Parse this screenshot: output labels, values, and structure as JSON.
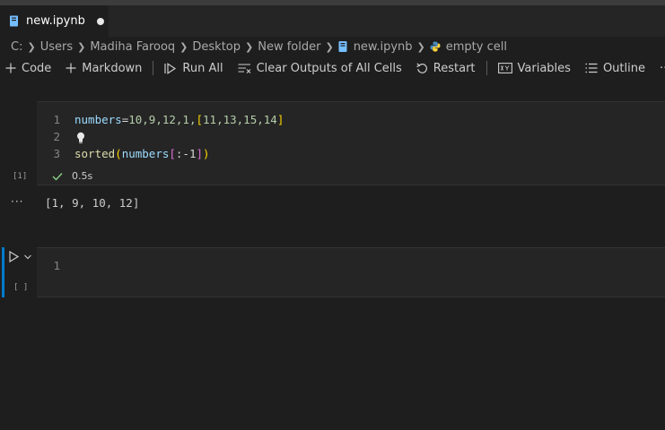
{
  "tab": {
    "title": "new.ipynb"
  },
  "breadcrumb": {
    "parts": [
      "C:",
      "Users",
      "Madiha Farooq",
      "Desktop",
      "New folder"
    ],
    "file": "new.ipynb",
    "cell": "empty cell"
  },
  "toolbar": {
    "code": "Code",
    "markdown": "Markdown",
    "run_all": "Run All",
    "clear_outputs": "Clear Outputs of All Cells",
    "restart": "Restart",
    "variables": "Variables",
    "outline": "Outline",
    "more": "···"
  },
  "cell1": {
    "line_numbers": [
      "1",
      "2",
      "3"
    ],
    "line1": {
      "var": "numbers",
      "eq": "=",
      "nums": "10,9,12,1,",
      "open": "[",
      "list": "11,13,15,14",
      "close": "]"
    },
    "line3": {
      "fn": "sorted",
      "open": "(",
      "var": "numbers",
      "sopen": "[",
      "slice": ":-1",
      "sclose": "]",
      "close": ")"
    },
    "exec_count": "[1]",
    "duration": "0.5s",
    "output_marker": "···",
    "output": "[1, 9, 10, 12]"
  },
  "cell2": {
    "line_numbers": [
      "1"
    ],
    "exec_count": "[ ]"
  },
  "colors": {
    "accent": "#007acc",
    "success": "#89d185",
    "lightbulb": "#e8e8e8"
  }
}
